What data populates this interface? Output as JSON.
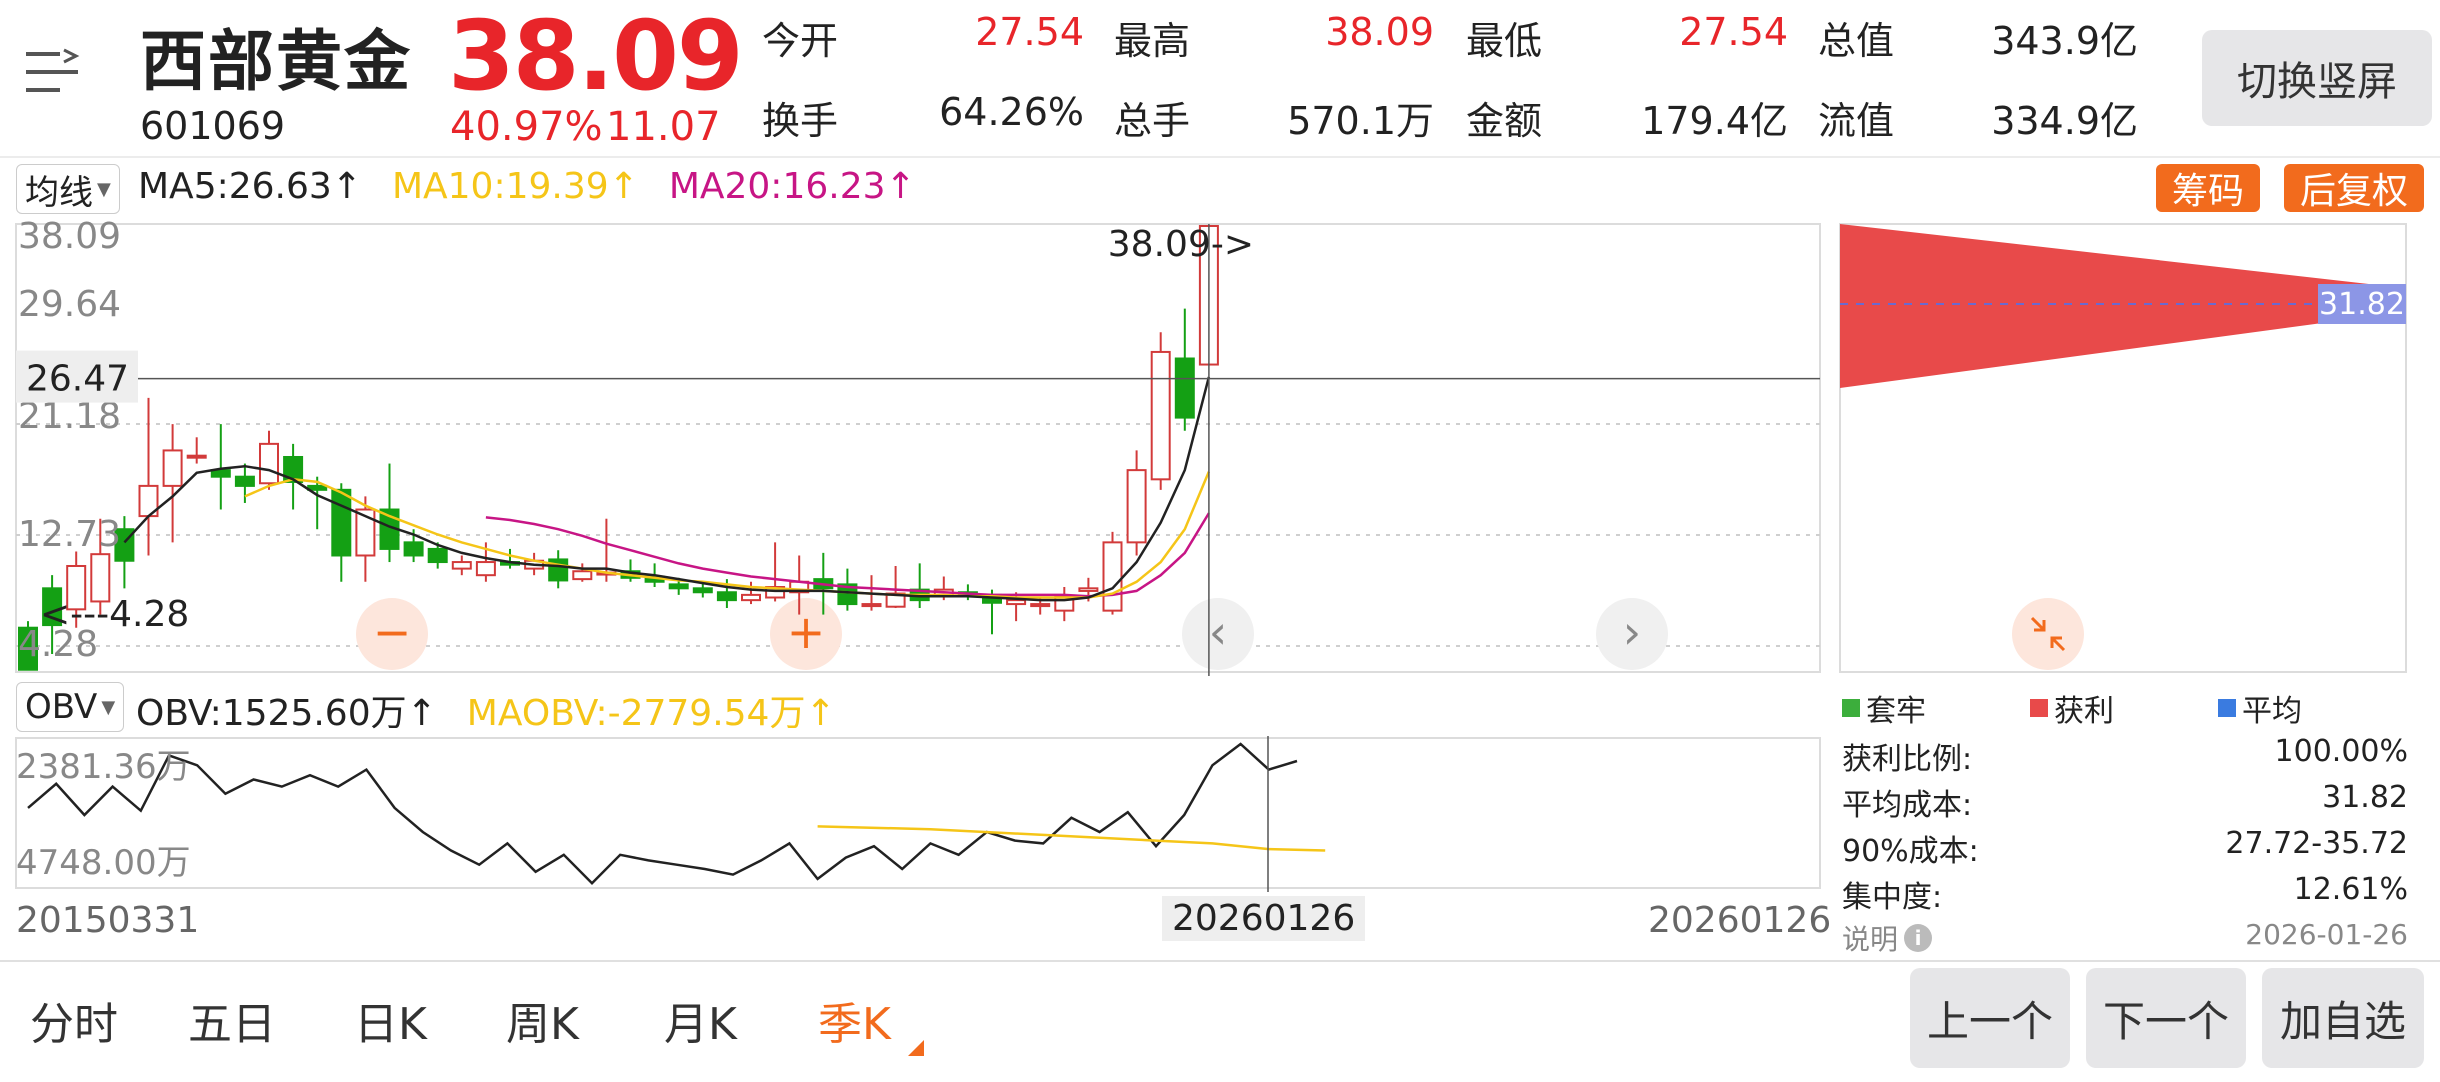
{
  "header": {
    "name": "西部黄金",
    "code": "601069",
    "price": "38.09",
    "change_pct": "40.97%",
    "change_amt": "11.07",
    "switch_button": "切换竖屏",
    "stats": [
      {
        "label": "今开",
        "value": "27.54",
        "color": "#e8252a"
      },
      {
        "label": "最高",
        "value": "38.09",
        "color": "#e8252a"
      },
      {
        "label": "最低",
        "value": "27.54",
        "color": "#e8252a"
      },
      {
        "label": "总值",
        "value": "343.9亿",
        "color": "#222222"
      },
      {
        "label": "换手",
        "value": "64.26%",
        "color": "#222222"
      },
      {
        "label": "总手",
        "value": "570.1万",
        "color": "#222222"
      },
      {
        "label": "金额",
        "value": "179.4亿",
        "color": "#222222"
      },
      {
        "label": "流值",
        "value": "334.9亿",
        "color": "#222222"
      }
    ]
  },
  "ma_legend": {
    "selector": "均线",
    "ma5": "MA5:26.63",
    "ma10": "MA10:19.39",
    "ma20": "MA20:16.23",
    "arrow": "↑",
    "colors": {
      "ma5": "#222222",
      "ma10": "#f5c518",
      "ma20": "#c71585"
    }
  },
  "chips_button": "筹码",
  "adjust_button": "后复权",
  "main_chart": {
    "y_labels": [
      "38.09",
      "29.64",
      "21.18",
      "12.73",
      "4.28"
    ],
    "crosshair_label": "26.47",
    "high_marker": "38.09->",
    "low_marker": "<---4.28",
    "colors": {
      "up": "#d23a3a",
      "down": "#14a014"
    }
  },
  "chart_data": {
    "type": "candlestick",
    "x_start_label": "20150331",
    "x_end_label": "20260126",
    "crosshair_date": "20260126",
    "y_range": [
      4.28,
      38.09
    ],
    "candles": [
      [
        7.5,
        4.3,
        8.0,
        4.28
      ],
      [
        10.5,
        7.7,
        11.5,
        5.5
      ],
      [
        8.9,
        12.2,
        13.3,
        7.5
      ],
      [
        9.5,
        13.1,
        15.8,
        8.5
      ],
      [
        15.0,
        12.6,
        16.0,
        10.5
      ],
      [
        16.0,
        18.3,
        25.0,
        13.0
      ],
      [
        18.3,
        21.0,
        23.0,
        14.0
      ],
      [
        20.5,
        20.6,
        22.0,
        20.0
      ],
      [
        19.5,
        19.0,
        23.0,
        16.5
      ],
      [
        19.0,
        18.3,
        20.0,
        17.0
      ],
      [
        18.5,
        21.5,
        22.5,
        18.0
      ],
      [
        20.5,
        18.6,
        21.5,
        16.5
      ],
      [
        18.3,
        18.0,
        19.0,
        15.0
      ],
      [
        18.0,
        13.0,
        18.5,
        11.0
      ],
      [
        13.0,
        16.5,
        17.5,
        11.0
      ],
      [
        16.5,
        13.5,
        20.0,
        12.5
      ],
      [
        14.0,
        13.0,
        15.0,
        12.5
      ],
      [
        13.5,
        12.5,
        14.0,
        12.0
      ],
      [
        12.0,
        12.5,
        13.0,
        11.5
      ],
      [
        11.5,
        12.5,
        14.0,
        11.0
      ],
      [
        12.5,
        12.3,
        13.5,
        12.0
      ],
      [
        12.0,
        12.6,
        13.2,
        11.5
      ],
      [
        12.7,
        11.1,
        13.4,
        10.5
      ],
      [
        11.2,
        11.8,
        12.4,
        11.0
      ],
      [
        11.6,
        11.7,
        15.8,
        11.0
      ],
      [
        11.8,
        11.3,
        12.7,
        11.0
      ],
      [
        11.4,
        11.0,
        12.4,
        10.6
      ],
      [
        10.8,
        10.5,
        11.3,
        10.0
      ],
      [
        10.5,
        10.2,
        11.0,
        9.8
      ],
      [
        10.2,
        9.6,
        11.2,
        9.0
      ],
      [
        9.6,
        10.0,
        11.0,
        9.3
      ],
      [
        9.8,
        10.6,
        14.0,
        9.5
      ],
      [
        10.2,
        11.0,
        13.0,
        8.5
      ],
      [
        11.2,
        10.5,
        13.2,
        8.5
      ],
      [
        10.8,
        9.3,
        12.0,
        8.8
      ],
      [
        9.3,
        9.3,
        11.5,
        8.8
      ],
      [
        9.1,
        10.1,
        12.2,
        9.0
      ],
      [
        10.4,
        9.6,
        12.4,
        9.0
      ],
      [
        9.9,
        10.4,
        11.4,
        9.6
      ],
      [
        10.2,
        10.1,
        10.8,
        9.6
      ],
      [
        10.0,
        9.4,
        10.4,
        7.0
      ],
      [
        9.3,
        9.6,
        10.2,
        8.0
      ],
      [
        9.3,
        9.3,
        9.8,
        8.5
      ],
      [
        8.8,
        9.9,
        10.6,
        8.0
      ],
      [
        10.3,
        10.5,
        11.3,
        9.5
      ],
      [
        8.8,
        14.0,
        14.8,
        8.5
      ],
      [
        14.0,
        19.5,
        21.0,
        13.0
      ],
      [
        18.8,
        28.5,
        30.0,
        18.0
      ],
      [
        28.0,
        23.5,
        31.8,
        22.5
      ],
      [
        27.54,
        38.09,
        38.09,
        27.54
      ]
    ],
    "ma5": [
      [
        4,
        14
      ],
      [
        5,
        16
      ],
      [
        6,
        17.5
      ],
      [
        7,
        19.3
      ],
      [
        8,
        19.6
      ],
      [
        9,
        19.8
      ],
      [
        10,
        19.5
      ],
      [
        11,
        18.8
      ],
      [
        12,
        17.6
      ],
      [
        13,
        16.8
      ],
      [
        14,
        16.0
      ],
      [
        15,
        15.2
      ],
      [
        16,
        14.6
      ],
      [
        17,
        13.8
      ],
      [
        18,
        13.2
      ],
      [
        19,
        12.8
      ],
      [
        20,
        12.5
      ],
      [
        21,
        12.3
      ],
      [
        22,
        12.2
      ],
      [
        23,
        12.0
      ],
      [
        24,
        12.0
      ],
      [
        25,
        11.7
      ],
      [
        26,
        11.5
      ],
      [
        27,
        11.2
      ],
      [
        28,
        10.9
      ],
      [
        29,
        10.6
      ],
      [
        30,
        10.4
      ],
      [
        31,
        10.3
      ],
      [
        32,
        10.3
      ],
      [
        33,
        10.3
      ],
      [
        34,
        10.2
      ],
      [
        35,
        10.1
      ],
      [
        36,
        10.0
      ],
      [
        37,
        9.9
      ],
      [
        38,
        9.9
      ],
      [
        39,
        9.9
      ],
      [
        40,
        9.8
      ],
      [
        41,
        9.7
      ],
      [
        42,
        9.6
      ],
      [
        43,
        9.6
      ],
      [
        44,
        9.8
      ],
      [
        45,
        10.5
      ],
      [
        46,
        12.5
      ],
      [
        47,
        15.5
      ],
      [
        48,
        19.5
      ],
      [
        49,
        26.6
      ]
    ],
    "ma10": [
      [
        9,
        17.5
      ],
      [
        10,
        18.3
      ],
      [
        11,
        18.8
      ],
      [
        12,
        18.6
      ],
      [
        13,
        17.8
      ],
      [
        14,
        16.8
      ],
      [
        15,
        16.0
      ],
      [
        16,
        15.3
      ],
      [
        17,
        14.6
      ],
      [
        18,
        14.0
      ],
      [
        19,
        13.5
      ],
      [
        20,
        13.0
      ],
      [
        21,
        12.6
      ],
      [
        22,
        12.3
      ],
      [
        23,
        12.0
      ],
      [
        24,
        11.7
      ],
      [
        25,
        11.5
      ],
      [
        26,
        11.3
      ],
      [
        27,
        11.1
      ],
      [
        28,
        11.0
      ],
      [
        29,
        10.8
      ],
      [
        30,
        10.6
      ],
      [
        31,
        10.5
      ],
      [
        32,
        10.4
      ],
      [
        33,
        10.3
      ],
      [
        34,
        10.2
      ],
      [
        35,
        10.1
      ],
      [
        36,
        10.0
      ],
      [
        37,
        10.0
      ],
      [
        38,
        10.0
      ],
      [
        39,
        9.9
      ],
      [
        40,
        9.9
      ],
      [
        41,
        9.8
      ],
      [
        42,
        9.8
      ],
      [
        43,
        9.8
      ],
      [
        44,
        9.8
      ],
      [
        45,
        10.1
      ],
      [
        46,
        11.0
      ],
      [
        47,
        12.5
      ],
      [
        48,
        15.0
      ],
      [
        49,
        19.39
      ]
    ],
    "ma20": [
      [
        19,
        15.9
      ],
      [
        20,
        15.7
      ],
      [
        21,
        15.4
      ],
      [
        22,
        15.0
      ],
      [
        23,
        14.5
      ],
      [
        24,
        13.9
      ],
      [
        25,
        13.4
      ],
      [
        26,
        12.9
      ],
      [
        27,
        12.4
      ],
      [
        28,
        12.0
      ],
      [
        29,
        11.7
      ],
      [
        30,
        11.4
      ],
      [
        31,
        11.2
      ],
      [
        32,
        11.0
      ],
      [
        33,
        10.8
      ],
      [
        34,
        10.6
      ],
      [
        35,
        10.5
      ],
      [
        36,
        10.4
      ],
      [
        37,
        10.3
      ],
      [
        38,
        10.2
      ],
      [
        39,
        10.1
      ],
      [
        40,
        10.0
      ],
      [
        41,
        10.0
      ],
      [
        42,
        10.0
      ],
      [
        43,
        10.0
      ],
      [
        44,
        9.9
      ],
      [
        45,
        10.0
      ],
      [
        46,
        10.3
      ],
      [
        47,
        11.5
      ],
      [
        48,
        13.2
      ],
      [
        49,
        16.23
      ]
    ]
  },
  "obv": {
    "selector": "OBV",
    "obv_label": "OBV:1525.60万",
    "maobv_label": "MAOBV:-2779.54万",
    "arrow": "↑",
    "y_top": "2381.36万",
    "y_bottom": "4748.00万",
    "colors": {
      "obv": "#222222",
      "maobv": "#f5c518"
    },
    "obv_values": [
      0.45,
      0.28,
      0.5,
      0.3,
      0.47,
      0.08,
      0.15,
      0.35,
      0.25,
      0.3,
      0.22,
      0.3,
      0.18,
      0.45,
      0.62,
      0.75,
      0.85,
      0.7,
      0.9,
      0.78,
      0.98,
      0.78,
      0.82,
      0.85,
      0.88,
      0.92,
      0.82,
      0.7,
      0.95,
      0.8,
      0.72,
      0.88,
      0.7,
      0.78,
      0.62,
      0.68,
      0.7,
      0.52,
      0.62,
      0.48,
      0.72,
      0.5,
      0.15,
      0.0,
      0.18,
      0.12
    ],
    "maobv_values": [
      [
        28,
        0.58
      ],
      [
        32,
        0.6
      ],
      [
        36,
        0.64
      ],
      [
        40,
        0.68
      ],
      [
        42,
        0.7
      ],
      [
        44,
        0.74
      ],
      [
        46,
        0.75
      ]
    ]
  },
  "chips": {
    "avg_label": "31.82",
    "legend": [
      {
        "label": "套牢",
        "color": "#3cae3c"
      },
      {
        "label": "获利",
        "color": "#e84a4a"
      },
      {
        "label": "平均",
        "color": "#3a7be0"
      }
    ],
    "rows": [
      {
        "label": "获利比例:",
        "value": "100.00%"
      },
      {
        "label": "平均成本:",
        "value": "31.82"
      },
      {
        "label": "90%成本:",
        "value": "27.72-35.72"
      },
      {
        "label": "集中度:",
        "value": "12.61%"
      }
    ],
    "explain": "说明",
    "date": "2026-01-26"
  },
  "tabs": [
    "分时",
    "五日",
    "日K",
    "周K",
    "月K",
    "季K"
  ],
  "active_tab": 5,
  "bottom_buttons": [
    "上一个",
    "下一个",
    "加自选"
  ]
}
